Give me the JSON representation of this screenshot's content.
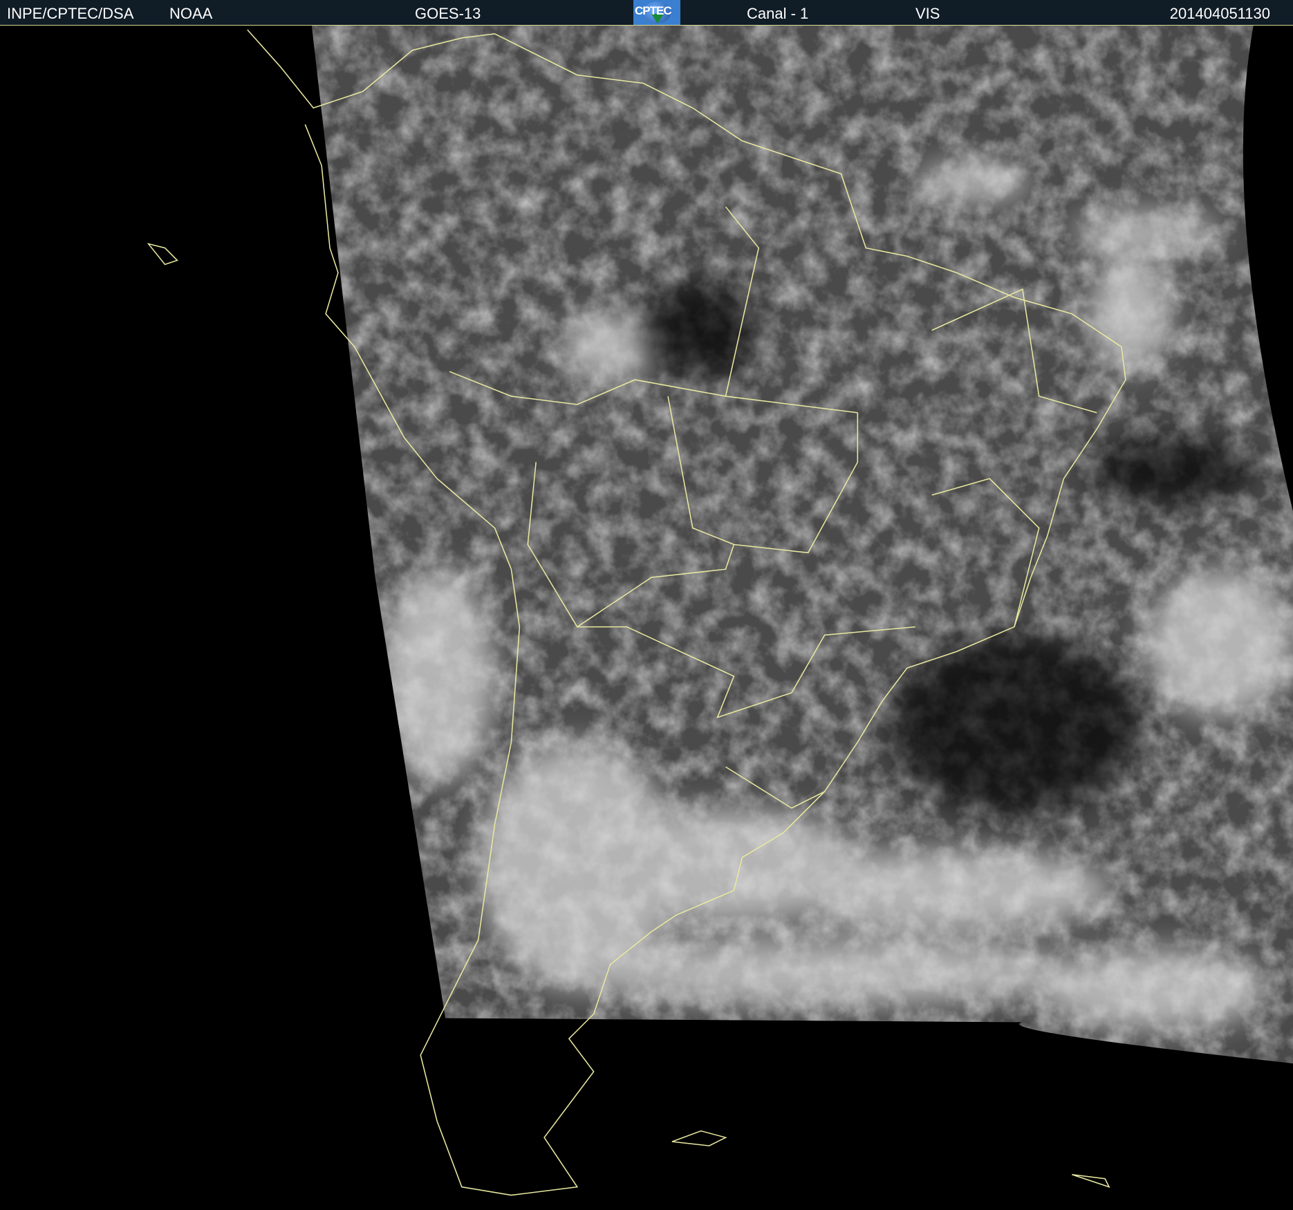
{
  "header": {
    "institution": "INPE/CPTEC/DSA",
    "agency": "NOAA",
    "satellite": "GOES-13",
    "logo_text": "CPTEC",
    "channel": "Canal - 1",
    "band": "VIS",
    "timestamp": "201404051130"
  },
  "colors": {
    "header_bg": "#101c26",
    "coastline": "#e8e8a0",
    "space": "#000000"
  }
}
